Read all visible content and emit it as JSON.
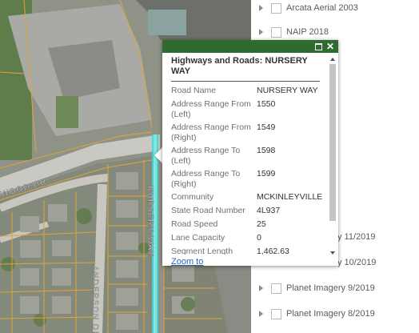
{
  "popup": {
    "title": "Highways and Roads: NURSERY WAY",
    "fields": [
      {
        "label": "Road Name",
        "value": "NURSERY WAY"
      },
      {
        "label": "Address Range From (Left)",
        "value": "1550"
      },
      {
        "label": "Address Range From (Right)",
        "value": "1549"
      },
      {
        "label": "Address Range To (Left)",
        "value": "1598"
      },
      {
        "label": "Address Range To (Right)",
        "value": "1599"
      },
      {
        "label": "Community",
        "value": "MCKINLEYVILLE"
      },
      {
        "label": "State Road Number",
        "value": "4L937"
      },
      {
        "label": "Road Speed",
        "value": "25"
      },
      {
        "label": "Lane Capacity",
        "value": "0"
      },
      {
        "label": "Segment Length",
        "value": "1,462.63"
      }
    ],
    "zoom_label": "Zoom to",
    "header_color": "#2e6b2e"
  },
  "layers": [
    {
      "label": "Arcata Aerial 2003"
    },
    {
      "label": "NAIP 2018"
    },
    {
      "label": "y 11/2019"
    },
    {
      "label": "y 10/2019"
    },
    {
      "label": "Planet Imagery 9/2019"
    },
    {
      "label": "Planet Imagery 8/2019"
    }
  ],
  "map": {
    "street_labels": [
      "NURSERY WAY",
      "WOOD DR",
      "ANDERSON DR"
    ],
    "highlight_color": "#49d3d3",
    "parcel_line_color": "#e2a33a"
  }
}
